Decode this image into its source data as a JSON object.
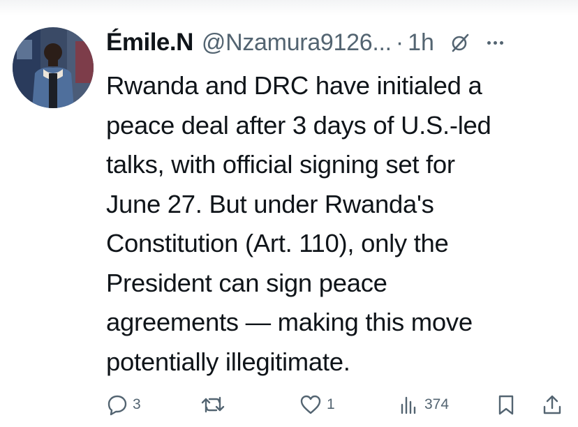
{
  "tweet": {
    "display_name": "Émile.N",
    "handle": "@Nzamura9126...",
    "separator": "·",
    "time": "1h",
    "text_lines": [
      "Rwanda and DRC have initialed a",
      "peace deal after 3 days of U.S.-led",
      "talks, with official signing set for",
      "June 27. But under Rwanda's",
      "Constitution (Art. 110), only the",
      "President can sign peace",
      "agreements — making this move",
      "potentially illegitimate."
    ]
  },
  "actions": {
    "reply_count": "3",
    "like_count": "1",
    "views_count": "374"
  },
  "icons": {
    "reply": "reply-icon",
    "retweet": "retweet-icon",
    "like": "heart-icon",
    "views": "views-icon",
    "bookmark": "bookmark-icon",
    "share": "share-icon",
    "grok": "grok-icon",
    "more": "more-icon"
  },
  "colors": {
    "text": "#0f1419",
    "secondary": "#536471"
  }
}
